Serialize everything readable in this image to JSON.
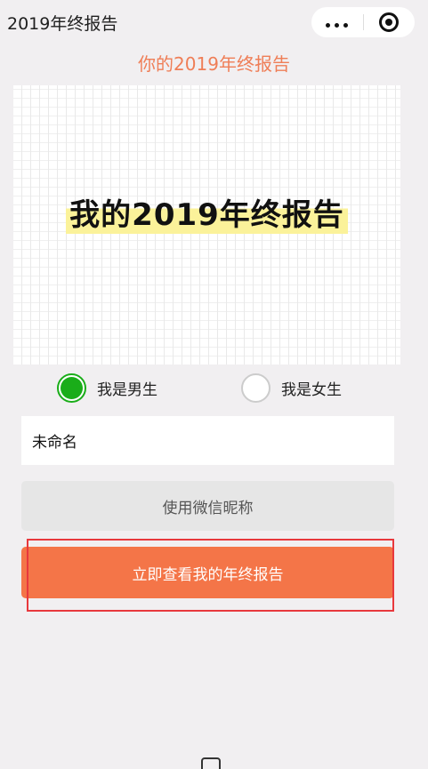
{
  "nav": {
    "title": "2019年终报告",
    "more_icon": "more-dots-icon",
    "close_icon": "target-close-icon"
  },
  "page": {
    "heading": "你的2019年终报告",
    "accent_color": "#ef7e57"
  },
  "banner": {
    "title": "我的2019年终报告",
    "highlight_color": "#fbf29a"
  },
  "gender": {
    "options": [
      {
        "label": "我是男生",
        "checked": true
      },
      {
        "label": "我是女生",
        "checked": false
      }
    ],
    "checked_color": "#1aad19"
  },
  "form": {
    "nickname_value": "未命名",
    "use_wechat_label": "使用微信昵称",
    "submit_label": "立即查看我的年终报告",
    "submit_color": "#f47548"
  },
  "annotation": {
    "highlight_color": "#e8383d"
  }
}
